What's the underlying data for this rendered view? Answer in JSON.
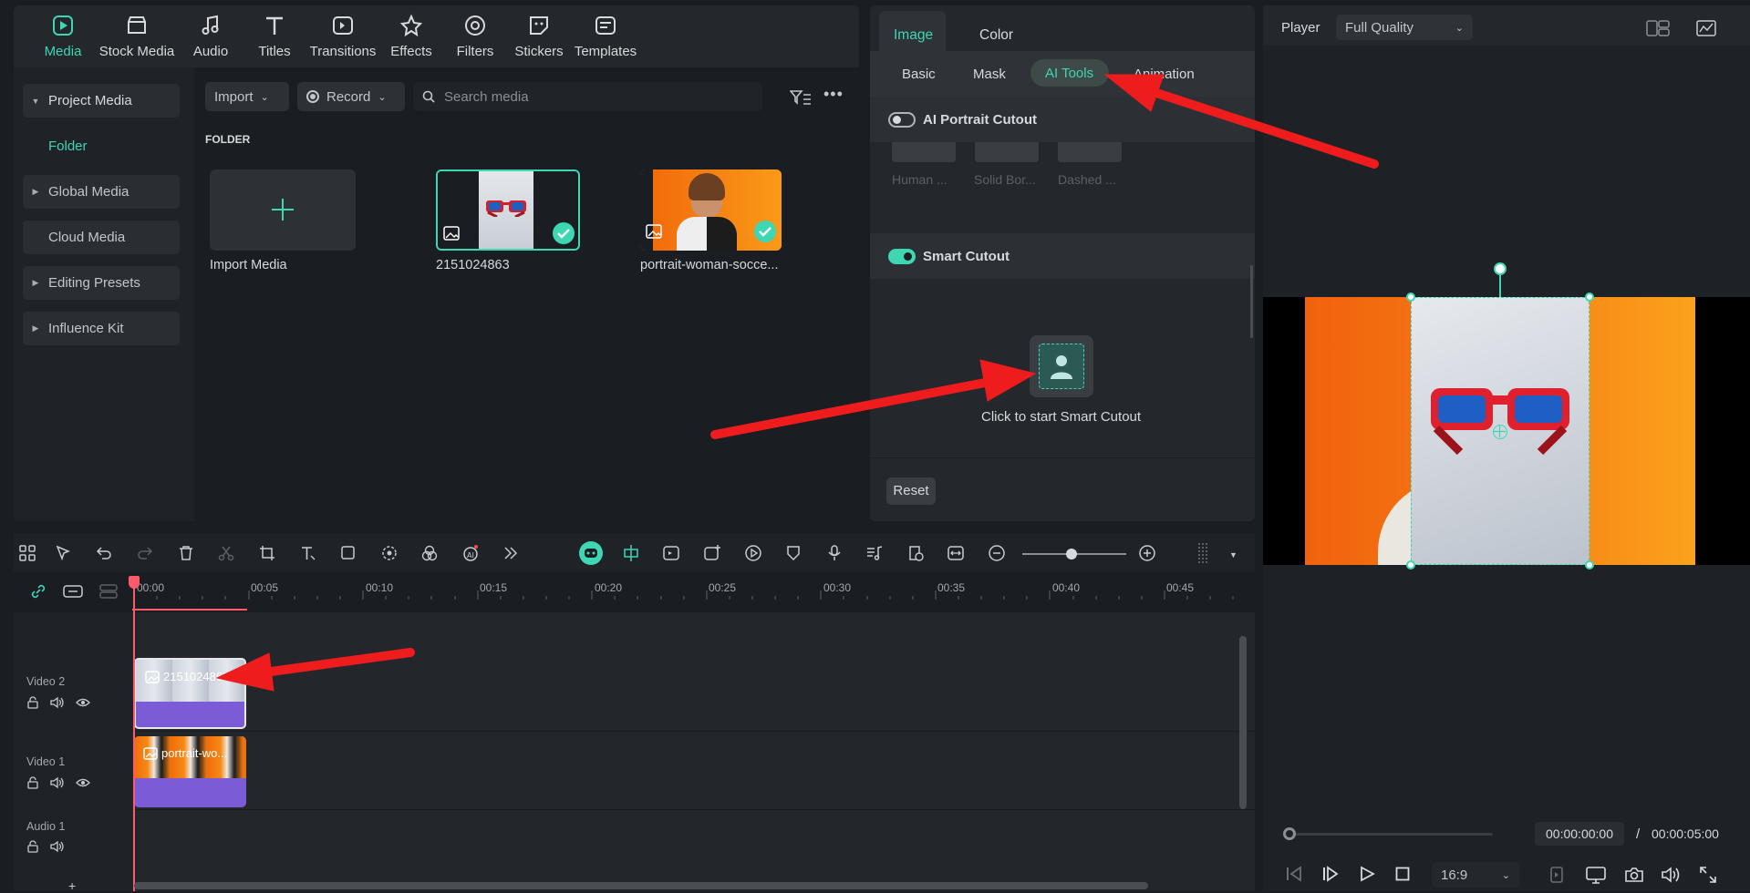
{
  "media_tabs": [
    {
      "label": "Media",
      "icon": "media-icon",
      "active": true
    },
    {
      "label": "Stock Media",
      "icon": "stock-media-icon"
    },
    {
      "label": "Audio",
      "icon": "audio-icon"
    },
    {
      "label": "Titles",
      "icon": "titles-icon"
    },
    {
      "label": "Transitions",
      "icon": "transitions-icon"
    },
    {
      "label": "Effects",
      "icon": "effects-icon"
    },
    {
      "label": "Filters",
      "icon": "filters-icon"
    },
    {
      "label": "Stickers",
      "icon": "stickers-icon"
    },
    {
      "label": "Templates",
      "icon": "templates-icon"
    }
  ],
  "sidebar": {
    "project_media": "Project Media",
    "folder": "Folder",
    "global_media": "Global Media",
    "cloud_media": "Cloud Media",
    "editing_presets": "Editing Presets",
    "influence_kit": "Influence Kit"
  },
  "media_toolbar": {
    "import": "Import",
    "record": "Record",
    "search_placeholder": "Search media"
  },
  "folder_heading": "FOLDER",
  "media_items": {
    "import_media": "Import Media",
    "item1": "2151024863",
    "item2": "portrait-woman-socce..."
  },
  "props": {
    "tab_image": "Image",
    "tab_color": "Color",
    "sub_basic": "Basic",
    "sub_mask": "Mask",
    "sub_ai_tools": "AI Tools",
    "sub_animation": "Animation",
    "ai_portrait_cutout": "AI Portrait Cutout",
    "presets": [
      "Human ...",
      "Solid Bor...",
      "Dashed ..."
    ],
    "smart_cutout": "Smart Cutout",
    "smart_cutout_hint": "Click to start Smart Cutout",
    "reset": "Reset"
  },
  "player": {
    "label": "Player",
    "quality": "Full Quality",
    "current_time": "00:00:00:00",
    "separator": "/",
    "total_time": "00:00:05:00",
    "aspect": "16:9"
  },
  "timeline": {
    "ruler": [
      "00:00",
      "00:05",
      "00:10",
      "00:15",
      "00:20",
      "00:25",
      "00:30",
      "00:35",
      "00:40",
      "00:45"
    ],
    "tracks": {
      "video2": "Video 2",
      "video1": "Video 1",
      "audio1": "Audio 1"
    },
    "clip_video2": "2151024863",
    "clip_video1": "portrait-wo...",
    "add_track": "+"
  },
  "colors": {
    "accent": "#3fd6b4",
    "arrow": "#ee1c1c",
    "playhead": "#ff5a6a",
    "clip_purple": "#7b5cd6"
  }
}
